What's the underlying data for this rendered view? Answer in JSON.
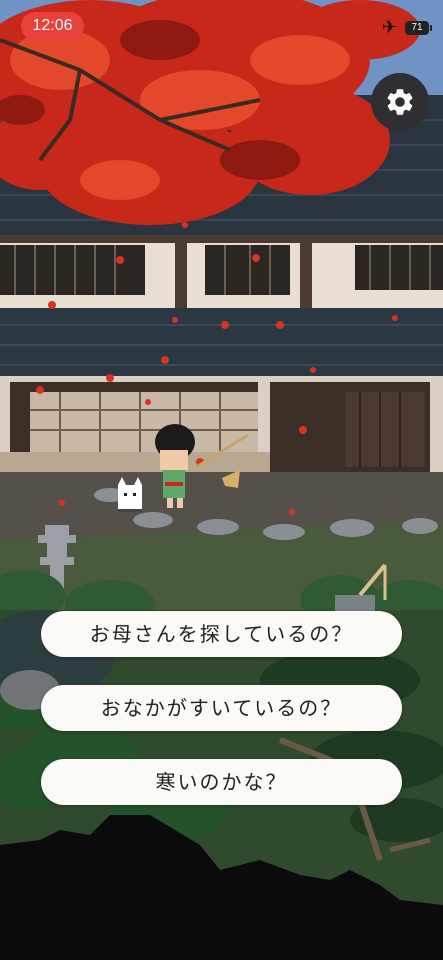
{
  "status_bar": {
    "time": "12:06",
    "airplane_icon": "airplane-icon",
    "battery_level": "71"
  },
  "settings": {
    "icon": "gear-icon"
  },
  "dialogue": {
    "choices": [
      "お母さんを探しているの？",
      "おなかがすいているの？",
      "寒いのかな？"
    ]
  },
  "colors": {
    "time_pill": "#e8403a",
    "maple_leaves": "#c8281a",
    "choice_bg": "#fcfaf6"
  }
}
